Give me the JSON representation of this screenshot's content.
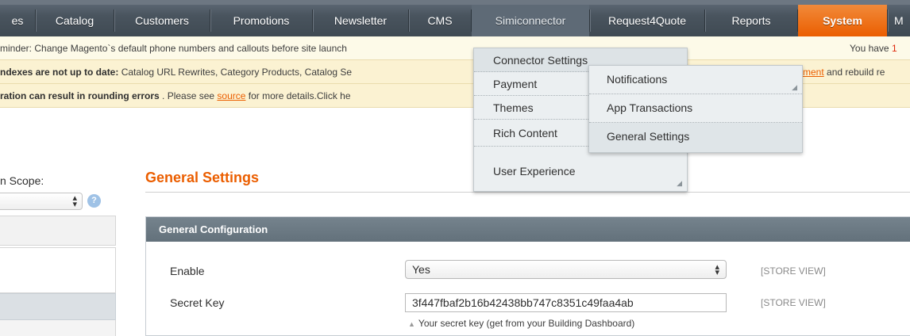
{
  "nav": {
    "items": [
      {
        "label": "es"
      },
      {
        "label": "Catalog"
      },
      {
        "label": "Customers"
      },
      {
        "label": "Promotions"
      },
      {
        "label": "Newsletter"
      },
      {
        "label": "CMS"
      },
      {
        "label": "Simiconnector"
      },
      {
        "label": "Request4Quote"
      },
      {
        "label": "Reports"
      },
      {
        "label": "System"
      },
      {
        "label": "M"
      }
    ],
    "active_color": "#eb5e00"
  },
  "notices": {
    "n1": {
      "text": "minder: Change Magento`s default phone numbers and callouts before site launch",
      "right": "You have ",
      "count": "1"
    },
    "n2": {
      "bold": "ndexes are not up to date:",
      "text": " Catalog URL Rewrites, Category Products, Catalog Se",
      "link": "ment",
      "right": " and rebuild re"
    },
    "n3": {
      "bold": "ration can result in rounding errors",
      "text": " . Please see ",
      "link": "source",
      "after": " for more details.Click he"
    }
  },
  "scope": {
    "label": "n Scope:",
    "help": "?"
  },
  "page": {
    "title": "General Settings",
    "accent_color": "#eb5e00"
  },
  "section": {
    "title": "General Configuration",
    "fields": {
      "enable": {
        "label": "Enable",
        "value": "Yes",
        "scope": "[STORE VIEW]"
      },
      "secret": {
        "label": "Secret Key",
        "value": "3f447fbaf2b16b42438bb747c8351c49faa4ab",
        "note": "Your secret key (get from your Building Dashboard)",
        "scope": "[STORE VIEW]"
      }
    }
  },
  "menu": {
    "items": [
      {
        "label": "Connector Settings"
      },
      {
        "label": "Payment"
      },
      {
        "label": "Themes"
      },
      {
        "label": "Rich Content"
      },
      {
        "label": "User Experience"
      }
    ]
  },
  "submenu": {
    "items": [
      {
        "label": "Notifications"
      },
      {
        "label": "App Transactions"
      },
      {
        "label": "General Settings"
      }
    ]
  }
}
